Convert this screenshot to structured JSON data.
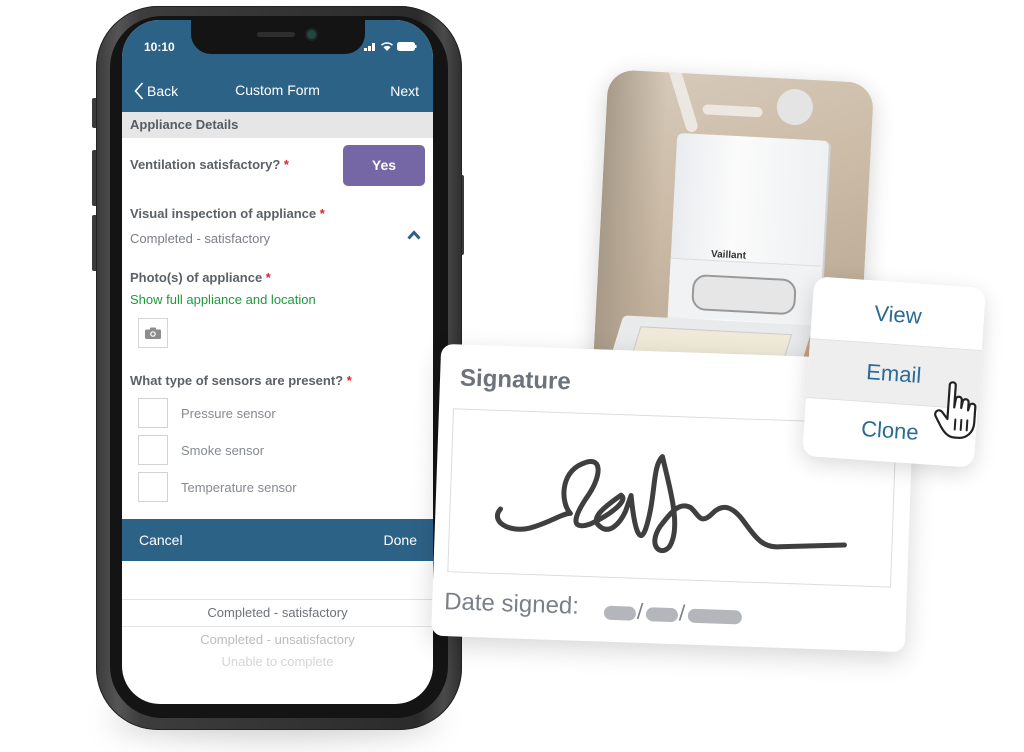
{
  "phone": {
    "status_bar": {
      "time": "10:10",
      "icons": [
        "signal-icon",
        "wifi-icon",
        "battery-icon"
      ]
    },
    "nav": {
      "back_label": "Back",
      "title": "Custom Form",
      "next_label": "Next"
    },
    "section_title": "Appliance Details",
    "fields": {
      "ventilation": {
        "label": "Ventilation satisfactory?",
        "required_mark": "*",
        "value": "Yes"
      },
      "visual_inspection": {
        "label": "Visual inspection of appliance",
        "required_mark": "*",
        "value": "Completed - satisfactory"
      },
      "photos": {
        "label": "Photo(s) of appliance",
        "required_mark": "*",
        "hint": "Show full appliance and location"
      },
      "sensors": {
        "label": "What type of sensors are present?",
        "required_mark": "*",
        "options": [
          {
            "label": "Pressure sensor",
            "checked": false
          },
          {
            "label": "Smoke sensor",
            "checked": false
          },
          {
            "label": "Temperature sensor",
            "checked": false
          }
        ]
      }
    },
    "action_bar": {
      "cancel_label": "Cancel",
      "done_label": "Done"
    },
    "picker": {
      "options": [
        "Completed - satisfactory",
        "Completed - unsatisfactory",
        "Unable to complete"
      ],
      "selected": "Completed - satisfactory"
    }
  },
  "photo": {
    "brand_text": "Vaillant"
  },
  "context_menu": {
    "items": [
      "View",
      "Email",
      "Clone"
    ],
    "highlighted": "Email"
  },
  "signature_card": {
    "title": "Signature",
    "date_label": "Date signed:",
    "date_separator": "/"
  },
  "colors": {
    "header_blue": "#2d6287",
    "yes_purple": "#7567a5",
    "required_red": "#e0242c",
    "hint_green": "#1e9a3c",
    "menu_text_blue": "#2a6a95"
  }
}
